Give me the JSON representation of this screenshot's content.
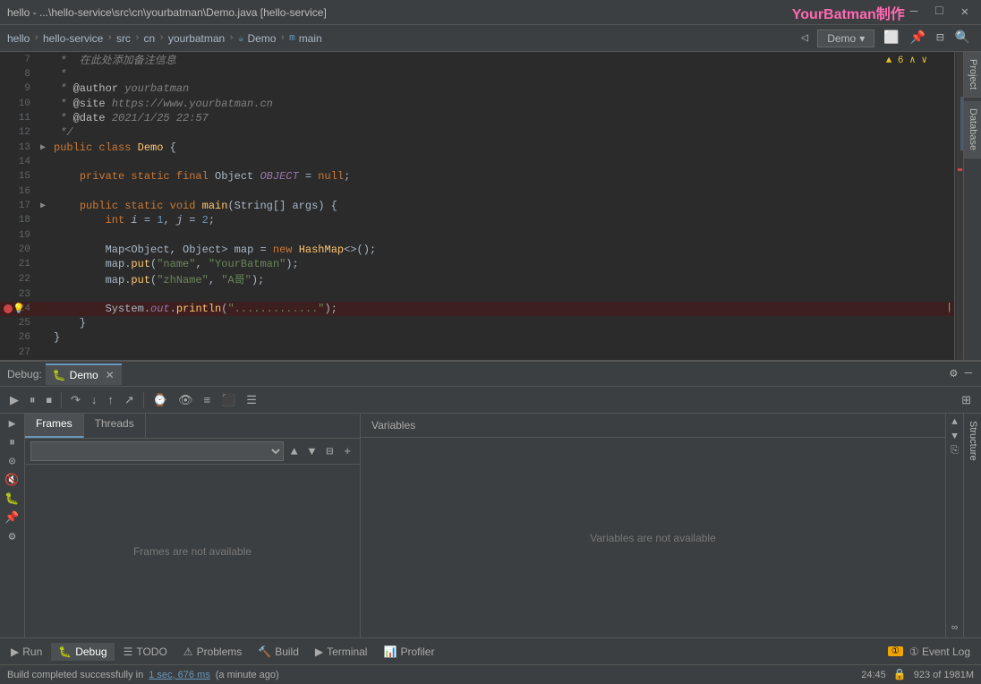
{
  "titleBar": {
    "title": "hello - ...\\hello-service\\src\\cn\\yourbatman\\Demo.java [hello-service]",
    "watermark": "YourBatman制作",
    "minimizeBtn": "—",
    "maximizeBtn": "□",
    "closeBtn": "✕"
  },
  "breadcrumb": {
    "items": [
      "hello",
      "hello-service",
      "src",
      "cn",
      "yourbatman",
      "Demo",
      "main"
    ],
    "separators": [
      ">",
      ">",
      ">",
      ">",
      ">",
      ">"
    ],
    "demoBtn": "Demo",
    "chevron": "▾"
  },
  "editor": {
    "lines": [
      {
        "num": 7,
        "content": " *  在此处添加备注信息",
        "type": "comment"
      },
      {
        "num": 8,
        "content": " *",
        "type": "comment"
      },
      {
        "num": 9,
        "content": " * @author yourbatman",
        "type": "comment"
      },
      {
        "num": 10,
        "content": " * @site https://www.yourbatman.cn",
        "type": "comment"
      },
      {
        "num": 11,
        "content": " * @date 2021/1/25 22:57",
        "type": "comment"
      },
      {
        "num": 12,
        "content": " */",
        "type": "comment"
      },
      {
        "num": 13,
        "content": "public class Demo {",
        "type": "code",
        "foldable": true
      },
      {
        "num": 14,
        "content": "",
        "type": "blank"
      },
      {
        "num": 15,
        "content": "    private static final Object OBJECT = null;",
        "type": "code"
      },
      {
        "num": 16,
        "content": "",
        "type": "blank"
      },
      {
        "num": 17,
        "content": "    public static void main(String[] args) {",
        "type": "code",
        "foldable": true
      },
      {
        "num": 18,
        "content": "        int i = 1, j = 2;",
        "type": "code"
      },
      {
        "num": 19,
        "content": "",
        "type": "blank"
      },
      {
        "num": 20,
        "content": "        Map<Object, Object> map = new HashMap<>();",
        "type": "code"
      },
      {
        "num": 21,
        "content": "        map.put(\"name\", \"YourBatman\");",
        "type": "code"
      },
      {
        "num": 22,
        "content": "        map.put(\"zhName\", \"A哥\");",
        "type": "code"
      },
      {
        "num": 23,
        "content": "",
        "type": "blank"
      },
      {
        "num": 24,
        "content": "        System.out.println(\".............\");",
        "type": "code",
        "breakpoint": true,
        "warning": true,
        "highlighted": true
      },
      {
        "num": 25,
        "content": "    }",
        "type": "code"
      },
      {
        "num": 26,
        "content": "}",
        "type": "code"
      },
      {
        "num": 27,
        "content": "",
        "type": "blank"
      }
    ],
    "warningCount": "▲ 6"
  },
  "rightPanels": [
    "Project",
    "Database"
  ],
  "debug": {
    "label": "Debug:",
    "tabName": "Demo",
    "closeBtn": "✕",
    "settingsBtn": "⚙",
    "minimizeBtn": "—"
  },
  "debugToolbar": {
    "buttons": [
      "▶",
      "⏸",
      "⏹",
      "↗",
      "↙",
      "↘",
      "↓",
      "⌚",
      "≡",
      "⬛",
      "☰"
    ]
  },
  "frames": {
    "tabs": [
      "Frames",
      "Threads"
    ],
    "activeTab": "Frames",
    "emptyText": "Frames are not available",
    "upBtn": "▲",
    "downBtn": "▼",
    "filterBtn": "⊟",
    "addBtn": "+"
  },
  "variables": {
    "header": "Variables",
    "emptyText": "Variables are not available"
  },
  "bottomToolbar": {
    "buttons": [
      {
        "label": "Run",
        "icon": "▶",
        "active": false
      },
      {
        "label": "Debug",
        "icon": "🐛",
        "active": true
      },
      {
        "label": "TODO",
        "icon": "☰",
        "active": false
      },
      {
        "label": "Problems",
        "icon": "⚠",
        "active": false
      },
      {
        "label": "Build",
        "icon": "🔨",
        "active": false
      },
      {
        "label": "Terminal",
        "icon": "▶",
        "active": false
      },
      {
        "label": "Profiler",
        "icon": "📊",
        "active": false
      }
    ],
    "eventLog": "① Event Log"
  },
  "statusBar": {
    "prefix": "Build completed successfully in",
    "highlight": "1 sec, 676 ms",
    "suffix": "(a minute ago)",
    "position": "24:45",
    "lockIcon": "🔒",
    "fileInfo": "923 of 1981M"
  }
}
